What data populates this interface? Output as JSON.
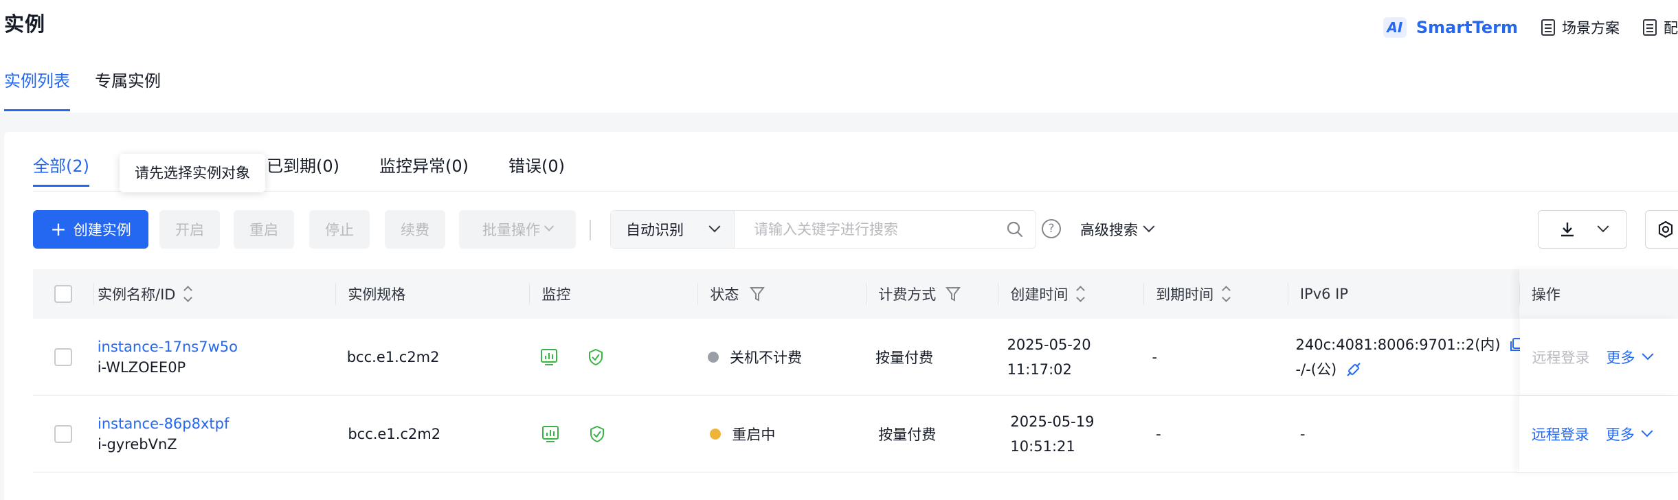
{
  "header": {
    "title": "实例",
    "smartterm_badge": "AI",
    "smartterm_label": "SmartTerm",
    "scene_label": "场景方案",
    "doc_label": "配"
  },
  "main_tabs": [
    {
      "label": "实例列表",
      "active": true
    },
    {
      "label": "专属实例",
      "active": false
    }
  ],
  "sub_tabs": [
    {
      "label": "全部(2)",
      "active": true
    },
    {
      "label": "已到期(0)",
      "active": false
    },
    {
      "label": "监控异常(0)",
      "active": false
    },
    {
      "label": "错误(0)",
      "active": false
    }
  ],
  "tooltip": "请先选择实例对象",
  "toolbar": {
    "create_label": "创建实例",
    "start_label": "开启",
    "restart_label": "重启",
    "stop_label": "停止",
    "renew_label": "续费",
    "batch_label": "批量操作",
    "search_mode": "自动识别",
    "search_placeholder": "请输入关键字进行搜索",
    "advanced_search": "高级搜索"
  },
  "table": {
    "columns": {
      "name": "实例名称/ID",
      "spec": "实例规格",
      "monitor": "监控",
      "status": "状态",
      "billing": "计费方式",
      "created": "创建时间",
      "expire": "到期时间",
      "ipv6": "IPv6 IP",
      "ops": "操作"
    },
    "rows": [
      {
        "name": "instance-17ns7w5o",
        "id": "i-WLZOEE0P",
        "spec": "bcc.e1.c2m2",
        "status": "关机不计费",
        "status_color": "#9b9ea6",
        "billing": "按量付费",
        "created_date": "2025-05-20",
        "created_time": "11:17:02",
        "expire": "-",
        "ipv6_line1": "240c:4081:8006:9701::2(内)",
        "ipv6_line2": "-/-(公)",
        "remote_login": "远程登录",
        "remote_enabled": false,
        "more": "更多"
      },
      {
        "name": "instance-86p8xtpf",
        "id": "i-gyrebVnZ",
        "spec": "bcc.e1.c2m2",
        "status": "重启中",
        "status_color": "#f0b43a",
        "billing": "按量付费",
        "created_date": "2025-05-19",
        "created_time": "10:51:21",
        "expire": "-",
        "ipv6_line1": "-",
        "ipv6_line2": "",
        "remote_login": "远程登录",
        "remote_enabled": true,
        "more": "更多"
      }
    ]
  },
  "colors": {
    "accent": "#2468f2",
    "monitor_green": "#3bb346"
  }
}
